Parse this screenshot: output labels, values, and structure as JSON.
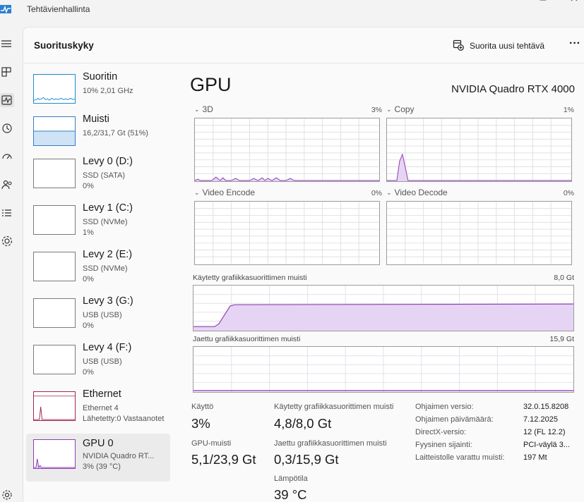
{
  "window": {
    "title": "Tehtävienhallinta"
  },
  "nav": {
    "items": [
      {
        "icon": "hamburger-menu-icon"
      },
      {
        "icon": "processes-icon"
      },
      {
        "icon": "performance-icon"
      },
      {
        "icon": "app-history-icon"
      },
      {
        "icon": "startup-apps-icon"
      },
      {
        "icon": "users-icon"
      },
      {
        "icon": "details-icon"
      },
      {
        "icon": "services-icon"
      },
      {
        "icon": "settings-icon"
      }
    ]
  },
  "header": {
    "title": "Suorituskyky",
    "run_task_label": "Suorita uusi tehtävä",
    "more_label": "···"
  },
  "devices": [
    {
      "name": "Suoritin",
      "line1": "10% 2,01 GHz",
      "line2": "",
      "graph": "cpu"
    },
    {
      "name": "Muisti",
      "line1": "16,2/31,7 Gt (51%)",
      "line2": "",
      "graph": "memory"
    },
    {
      "name": "Levy 0 (D:)",
      "line1": "SSD (SATA)",
      "line2": "0%",
      "graph": "empty"
    },
    {
      "name": "Levy 1 (C:)",
      "line1": "SSD (NVMe)",
      "line2": "1%",
      "graph": "empty"
    },
    {
      "name": "Levy 2 (E:)",
      "line1": "SSD (NVMe)",
      "line2": "0%",
      "graph": "empty"
    },
    {
      "name": "Levy 3 (G:)",
      "line1": "USB (USB)",
      "line2": "0%",
      "graph": "empty"
    },
    {
      "name": "Levy 4 (F:)",
      "line1": "USB (USB)",
      "line2": "0%",
      "graph": "empty"
    },
    {
      "name": "Ethernet",
      "line1": "Ethernet 4",
      "line2": "Lähetetty:0 Vastaanotet",
      "graph": "ethernet"
    },
    {
      "name": "GPU 0",
      "line1": "NVIDIA Quadro RT...",
      "line2": "3% (39 °C)",
      "graph": "gpu",
      "selected": true
    }
  ],
  "gpu": {
    "heading": "GPU",
    "model": "NVIDIA Quadro RTX 4000",
    "engines": [
      {
        "label": "3D",
        "value": "3%"
      },
      {
        "label": "Copy",
        "value": "1%"
      },
      {
        "label": "Video Encode",
        "value": "0%"
      },
      {
        "label": "Video Decode",
        "value": "0%"
      }
    ],
    "dedicated_memory": {
      "label": "Käytetty grafiikkasuorittimen muisti",
      "max": "8,0 Gt"
    },
    "shared_memory": {
      "label": "Jaettu grafiikkasuorittimen muisti",
      "max": "15,9 Gt"
    }
  },
  "stats": {
    "utilization": {
      "label": "Käyttö",
      "value": "3%"
    },
    "gpu_memory": {
      "label": "GPU-muisti",
      "value": "5,1/23,9 Gt"
    },
    "dedicated": {
      "label": "Käytetty grafiikkasuorittimen muisti",
      "value": "4,8/8,0 Gt"
    },
    "shared": {
      "label": "Jaettu grafiikkasuorittimen muisti",
      "value": "0,3/15,9 Gt"
    },
    "temperature": {
      "label": "Lämpötila",
      "value": "39 °C"
    }
  },
  "info": [
    {
      "key": "Ohjaimen versio:",
      "value": "32.0.15.8208"
    },
    {
      "key": "Ohjaimen päivämäärä:",
      "value": "7.12.2025"
    },
    {
      "key": "DirectX-versio:",
      "value": "12 (FL 12.2)"
    },
    {
      "key": "Fyysinen sijainti:",
      "value": "PCI-väylä 3..."
    },
    {
      "key": "Laitteistolle varattu muisti:",
      "value": "197 Mt"
    }
  ],
  "colors": {
    "gpu_accent": "#8e3fb3",
    "gpu_fill": "#e6d4f4",
    "cpu_accent": "#1f8ac9",
    "memory_fill": "#cfe3f7",
    "memory_accent": "#3a7cc0",
    "ethernet_accent": "#a0284a",
    "grid": "#e0e0e0"
  }
}
